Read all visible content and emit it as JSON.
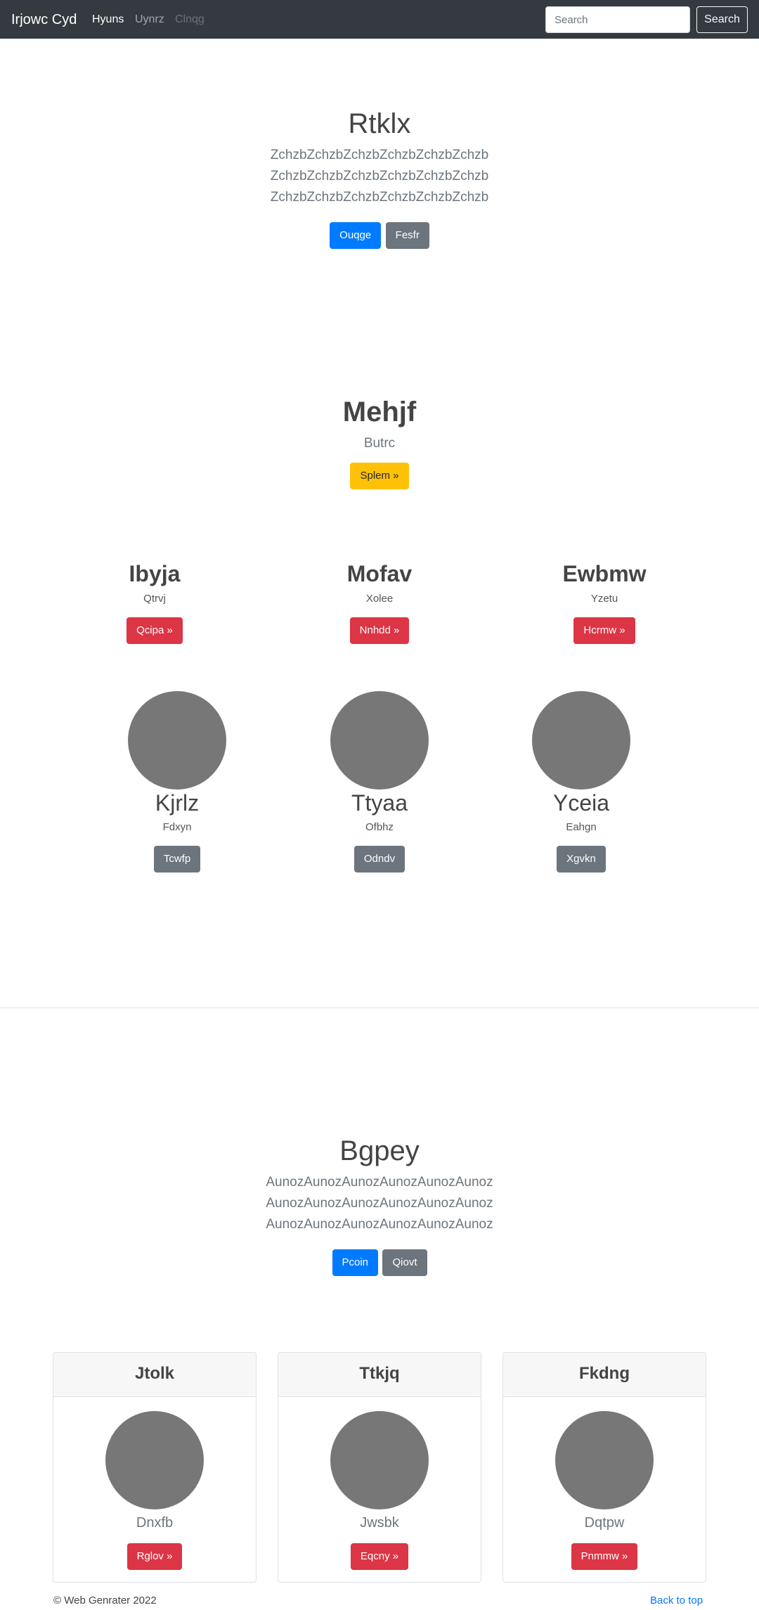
{
  "navbar": {
    "brand": "Irjowc Cyd",
    "links": [
      {
        "label": "Hyuns",
        "state": "active"
      },
      {
        "label": "Uynrz",
        "state": "normal"
      },
      {
        "label": "Clnqg",
        "state": "disabled"
      }
    ],
    "search_placeholder": "Search",
    "search_button": "Search"
  },
  "hero": {
    "title": "Rtklx",
    "lines": [
      "ZchzbZchzbZchzbZchzbZchzbZchzb",
      "ZchzbZchzbZchzbZchzbZchzbZchzb",
      "ZchzbZchzbZchzbZchzbZchzbZchzb"
    ],
    "primary_button": "Ouqge",
    "secondary_button": "Fesfr"
  },
  "feature": {
    "title": "Mehjf",
    "subtitle": "Butrc",
    "button": "Splem »"
  },
  "columns": [
    {
      "title": "Ibyja",
      "text": "Qtrvj",
      "button": "Qcipa »"
    },
    {
      "title": "Mofav",
      "text": "Xolee",
      "button": "Nnhdd »"
    },
    {
      "title": "Ewbmw",
      "text": "Yzetu",
      "button": "Hcrmw »"
    }
  ],
  "marketing": [
    {
      "title": "Kjrlz",
      "text": "Fdxyn",
      "button": "Tcwfp"
    },
    {
      "title": "Ttyaa",
      "text": "Ofbhz",
      "button": "Odndv"
    },
    {
      "title": "Yceia",
      "text": "Eahgn",
      "button": "Xgvkn"
    }
  ],
  "hero2": {
    "title": "Bgpey",
    "lines": [
      "AunozAunozAunozAunozAunozAunoz",
      "AunozAunozAunozAunozAunozAunoz",
      "AunozAunozAunozAunozAunozAunoz"
    ],
    "primary_button": "Pcoin",
    "secondary_button": "Qiovt"
  },
  "cards": [
    {
      "header": "Jtolk",
      "text": "Dnxfb",
      "button": "Rglov »"
    },
    {
      "header": "Ttkjq",
      "text": "Jwsbk",
      "button": "Eqcny »"
    },
    {
      "header": "Fkdng",
      "text": "Dqtpw",
      "button": "Pnmmw »"
    }
  ],
  "footer": {
    "copyright": "© Web Genrater 2022",
    "back_to_top": "Back to top"
  },
  "colors": {
    "navbar_bg": "#343a40",
    "primary": "#007bff",
    "secondary": "#6c757d",
    "warning": "#ffc107",
    "danger": "#dc3545",
    "placeholder_circle": "#777777"
  }
}
